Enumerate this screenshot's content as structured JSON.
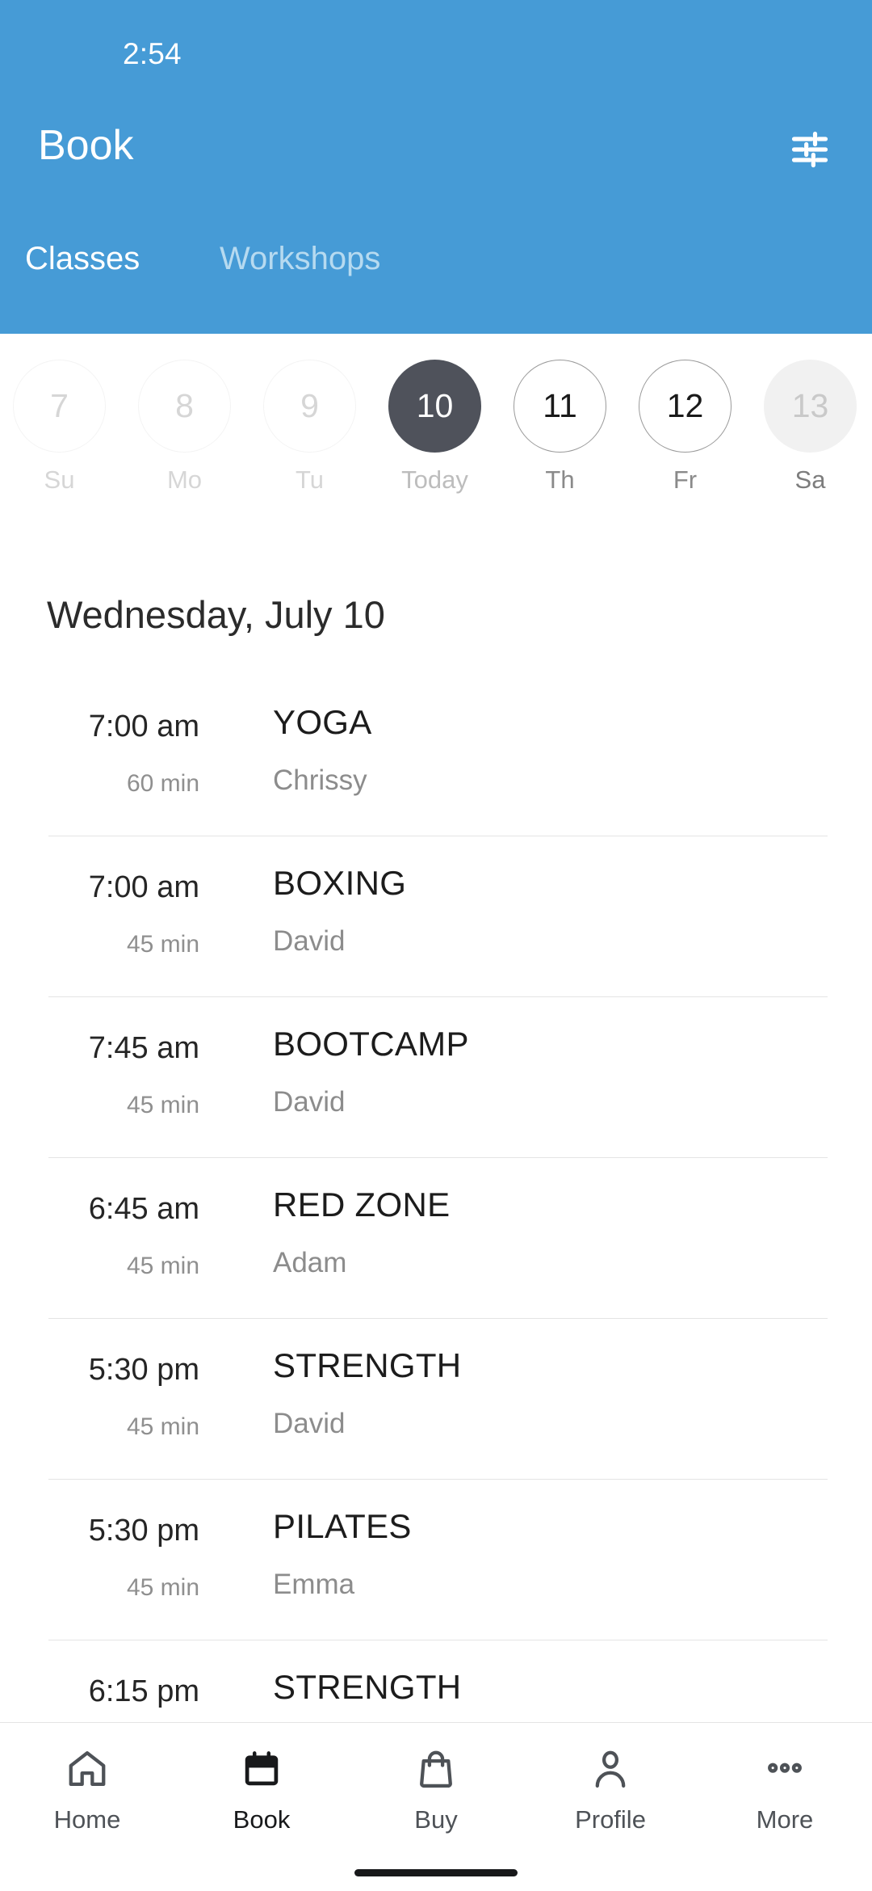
{
  "status_bar": {
    "time": "2:54"
  },
  "header": {
    "title": "Book",
    "filter_icon": "tune-filter-icon",
    "background_color": "#469BD6",
    "tabs": [
      {
        "label": "Classes",
        "active": true
      },
      {
        "label": "Workshops",
        "active": false
      }
    ]
  },
  "date_strip": {
    "days": [
      {
        "day_number": "7",
        "weekday": "Su",
        "state": "past"
      },
      {
        "day_number": "8",
        "weekday": "Mo",
        "state": "past"
      },
      {
        "day_number": "9",
        "weekday": "Tu",
        "state": "past"
      },
      {
        "day_number": "10",
        "weekday": "Today",
        "state": "selected"
      },
      {
        "day_number": "11",
        "weekday": "Th",
        "state": "future"
      },
      {
        "day_number": "12",
        "weekday": "Fr",
        "state": "future"
      },
      {
        "day_number": "13",
        "weekday": "Sa",
        "state": "edge"
      }
    ],
    "selected_color": "#4F525B"
  },
  "schedule": {
    "day_heading": "Wednesday, July 10",
    "classes": [
      {
        "time": "7:00 am",
        "duration": "60 min",
        "name": "YOGA",
        "coach": "Chrissy"
      },
      {
        "time": "7:00 am",
        "duration": "45 min",
        "name": "BOXING",
        "coach": "David"
      },
      {
        "time": "7:45 am",
        "duration": "45 min",
        "name": "BOOTCAMP",
        "coach": "David"
      },
      {
        "time": "6:45 am",
        "duration": "45 min",
        "name": "RED ZONE",
        "coach": "Adam"
      },
      {
        "time": "5:30 pm",
        "duration": "45 min",
        "name": "STRENGTH",
        "coach": "David"
      },
      {
        "time": "5:30 pm",
        "duration": "45 min",
        "name": "PILATES",
        "coach": "Emma"
      },
      {
        "time": "6:15 pm",
        "duration": "",
        "name": "STRENGTH",
        "coach": ""
      }
    ]
  },
  "bottom_nav": {
    "items": [
      {
        "label": "Home",
        "icon": "home-icon",
        "active": false
      },
      {
        "label": "Book",
        "icon": "calendar-icon",
        "active": true
      },
      {
        "label": "Buy",
        "icon": "shopping-bag-icon",
        "active": false
      },
      {
        "label": "Profile",
        "icon": "person-icon",
        "active": false
      },
      {
        "label": "More",
        "icon": "more-dots-icon",
        "active": false
      }
    ]
  }
}
